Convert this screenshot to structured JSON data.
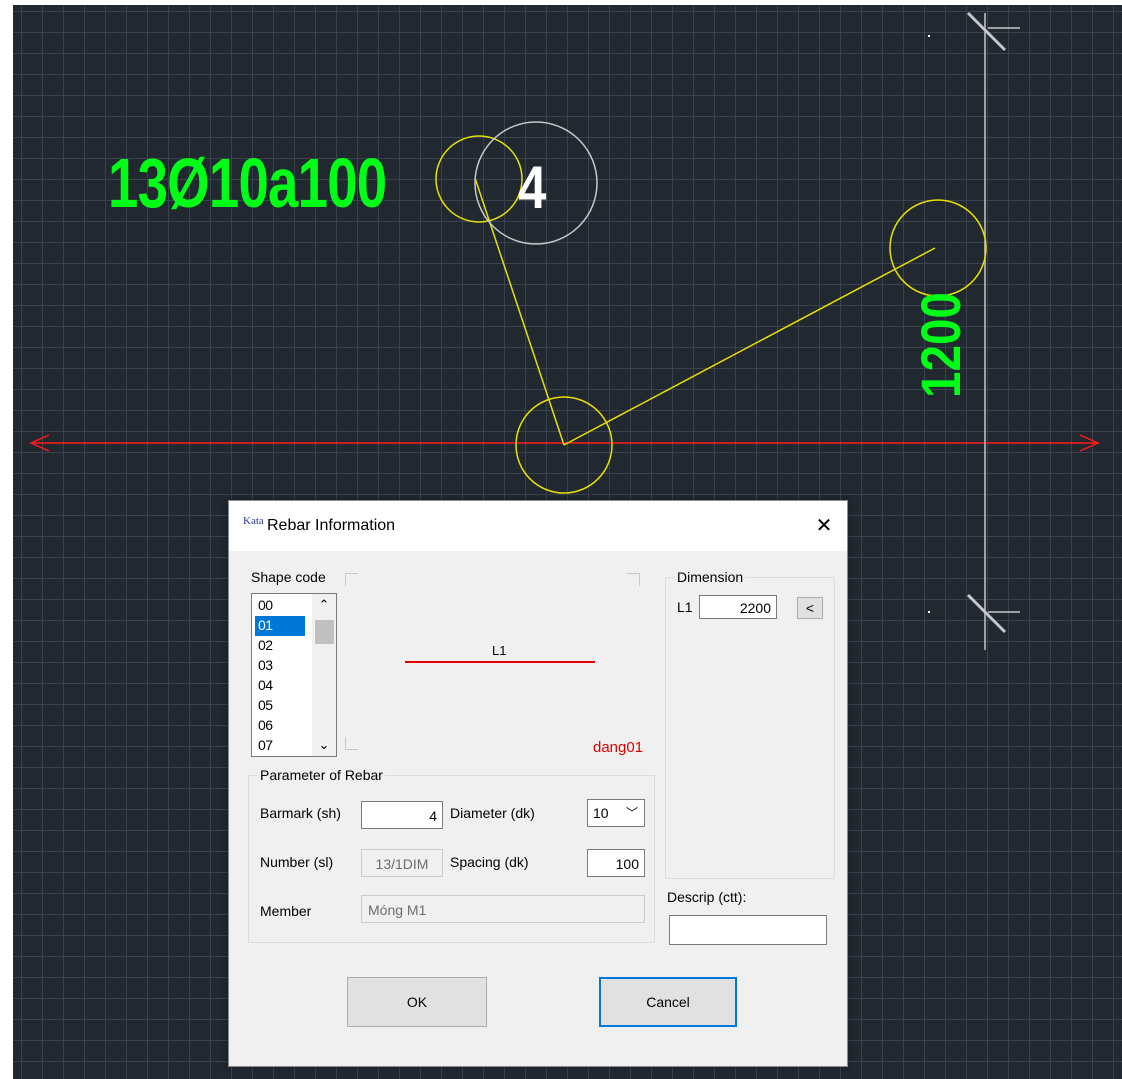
{
  "drawing": {
    "rebar_label": "13Ø10a100",
    "mark_number": "4",
    "dimension_value": "1200",
    "colors": {
      "background": "#212830",
      "grid": "#3a4250",
      "text_green": "#00ff16",
      "leader": "#e8e000",
      "axis": "#ff1a1a",
      "dimension_line": "#c8c8c8"
    }
  },
  "dialog": {
    "icon_text": "Kata",
    "title": "Rebar Information",
    "close_label": "✕",
    "shape_code_label": "Shape code",
    "shape_codes": [
      "00",
      "01",
      "02",
      "03",
      "04",
      "05",
      "06",
      "07"
    ],
    "selected_shape": "01",
    "preview_dim_label": "L1",
    "preview_name": "dang01",
    "dimension_group_label": "Dimension",
    "l1_label": "L1",
    "l1_value": "2200",
    "pick_button_label": "<",
    "params_group_label": "Parameter of Rebar",
    "barmark_label": "Barmark (sh)",
    "barmark_value": "4",
    "diameter_label": "Diameter (dk)",
    "diameter_value": "10",
    "number_label": "Number (sl)",
    "number_value": "13/1DIM",
    "spacing_label": "Spacing (dk)",
    "spacing_value": "100",
    "member_label": "Member",
    "member_value": "Móng M1",
    "descrip_label": "Descrip (ctt):",
    "descrip_value": "",
    "ok_label": "OK",
    "cancel_label": "Cancel",
    "accent_color": "#0078d7"
  }
}
